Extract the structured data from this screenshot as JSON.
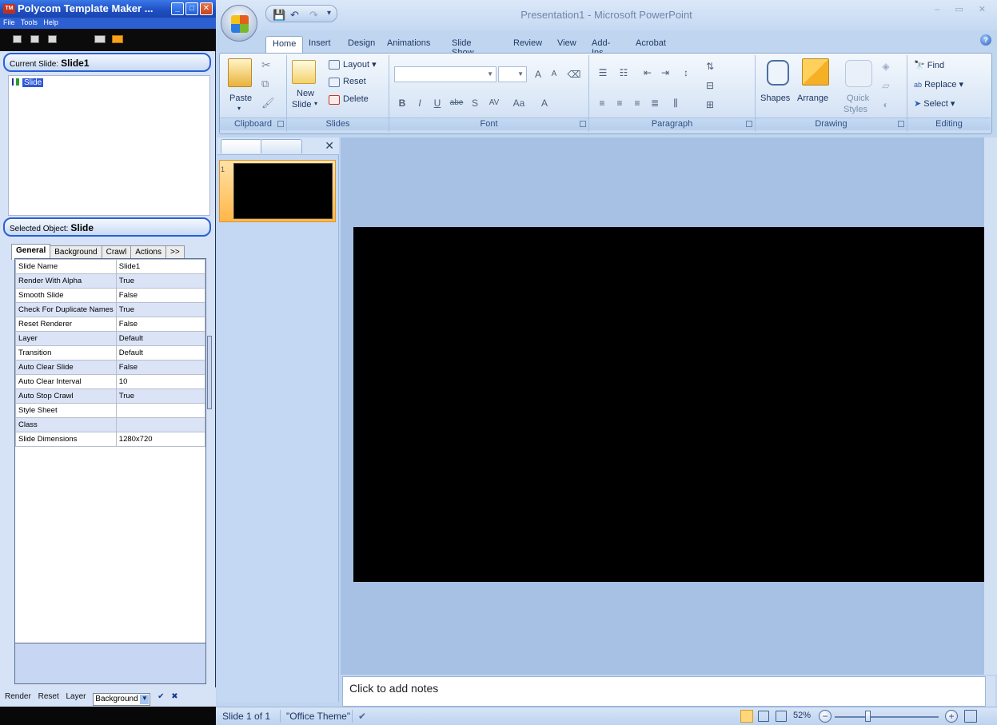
{
  "ptm": {
    "title": "Polycom Template Maker ...",
    "app_icon": "TM",
    "menu": [
      "File",
      "Tools",
      "Help"
    ],
    "current_slide_label": "Current Slide:",
    "current_slide_value": "Slide1",
    "tree_item": "Slide",
    "selected_object_label": "Selected Object:",
    "selected_object_value": "Slide",
    "tabs": [
      "General",
      "Background",
      "Crawl",
      "Actions",
      ">>"
    ],
    "properties": [
      {
        "name": "Slide Name",
        "value": "Slide1"
      },
      {
        "name": "Render With Alpha",
        "value": "True"
      },
      {
        "name": "Smooth Slide",
        "value": "False"
      },
      {
        "name": "Check For Duplicate Names",
        "value": "True"
      },
      {
        "name": "Reset Renderer",
        "value": "False"
      },
      {
        "name": "Layer",
        "value": "Default"
      },
      {
        "name": "Transition",
        "value": "Default"
      },
      {
        "name": "Auto Clear Slide",
        "value": "False"
      },
      {
        "name": "Auto Clear Interval",
        "value": "10"
      },
      {
        "name": "Auto Stop Crawl",
        "value": "True"
      },
      {
        "name": "Style Sheet",
        "value": ""
      },
      {
        "name": "Class",
        "value": ""
      },
      {
        "name": "Slide Dimensions",
        "value": "1280x720"
      }
    ],
    "bottom": {
      "render": "Render",
      "reset": "Reset",
      "layer": "Layer",
      "select_value": "Background",
      "apply": "✔",
      "cancel": "✖"
    }
  },
  "ppt": {
    "title": "Presentation1 - Microsoft PowerPoint",
    "window_controls": "– ▭ ✕",
    "tabs": [
      "Home",
      "Insert",
      "Design",
      "Animations",
      "Slide Show",
      "Review",
      "View",
      "Add-Ins",
      "Acrobat"
    ],
    "groups": {
      "clipboard": {
        "label": "Clipboard",
        "paste": "Paste"
      },
      "slides": {
        "label": "Slides",
        "new_slide_1": "New",
        "new_slide_2": "Slide",
        "layout": "Layout",
        "reset": "Reset",
        "delete": "Delete"
      },
      "font": {
        "label": "Font",
        "bold": "B",
        "italic": "I",
        "underline": "U",
        "strike": "abe",
        "shadow": "S",
        "spacing": "AV",
        "case": "Aa",
        "color": "A",
        "grow": "A",
        "shrink": "A"
      },
      "paragraph": {
        "label": "Paragraph"
      },
      "drawing": {
        "label": "Drawing",
        "shapes": "Shapes",
        "arrange": "Arrange",
        "quick_styles_1": "Quick",
        "quick_styles_2": "Styles"
      },
      "editing": {
        "label": "Editing",
        "find": "Find",
        "replace": "Replace",
        "select": "Select"
      }
    },
    "notes_placeholder": "Click to add notes",
    "thumb_number": "1",
    "status": {
      "slide": "Slide 1 of 1",
      "theme": "\"Office Theme\"",
      "zoom": "52%"
    }
  }
}
